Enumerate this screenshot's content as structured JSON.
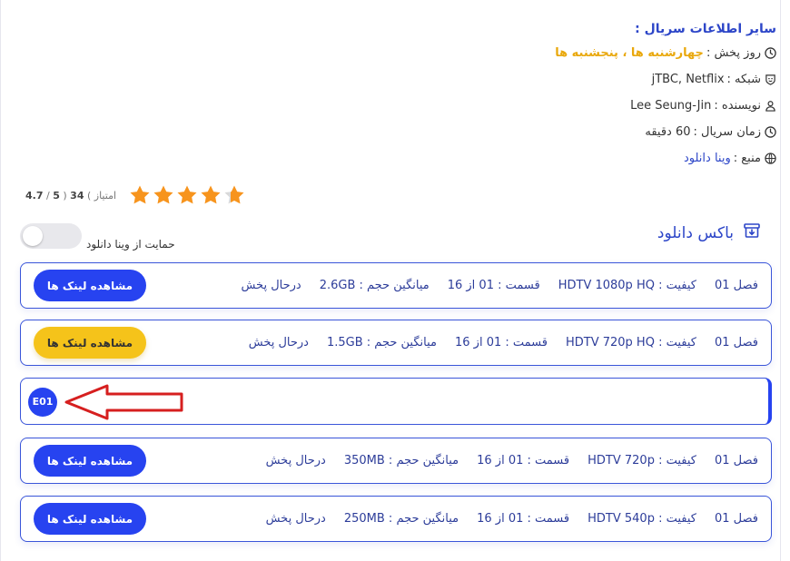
{
  "info": {
    "title": "سایر اطلاعات سریال :",
    "air_day_label": "روز پخش :",
    "air_day_value": "چهارشنبه ها ، پنجشنبه ها",
    "network_label": "شبکه :",
    "network_value": "jTBC, Netflix",
    "writer_label": "نویسنده :",
    "writer_value": "Lee Seung-Jin",
    "duration_label": "زمان سریال :",
    "duration_value": "60 دقیقه",
    "source_label": "منبع :",
    "source_value": "وینا دانلود"
  },
  "rating": {
    "score": "4.7",
    "sep": "/",
    "max": "5",
    "count_open": "(",
    "count": "34",
    "count_label": "امتیاز )",
    "stars_value": 4.7,
    "star_color": "#f7941d"
  },
  "download_box": {
    "title": "باکس دانلود",
    "support_label": "حمایت از وینا دانلود",
    "support_enabled": false
  },
  "rows": [
    {
      "season": "فصل 01",
      "quality": "کیفیت : HDTV 1080p HQ",
      "episode": "قسمت : 01 از 16",
      "size": "میانگین حجم : 2.6GB",
      "status": "درحال پخش",
      "button": "مشاهده لینک ها",
      "button_color": "#2743f0"
    },
    {
      "season": "فصل 01",
      "quality": "کیفیت : HDTV 720p HQ",
      "episode": "قسمت : 01 از 16",
      "size": "میانگین حجم : 1.5GB",
      "status": "درحال پخش",
      "button": "مشاهده لینک ها",
      "button_color": "#f5c31a"
    },
    {
      "season": "فصل 01",
      "quality": "کیفیت : HDTV 720p",
      "episode": "قسمت : 01 از 16",
      "size": "میانگین حجم : 350MB",
      "status": "درحال پخش",
      "button": "مشاهده لینک ها",
      "button_color": "#2743f0"
    },
    {
      "season": "فصل 01",
      "quality": "کیفیت : HDTV 540p",
      "episode": "قسمت : 01 از 16",
      "size": "میانگین حجم : 250MB",
      "status": "درحال پخش",
      "button": "مشاهده لینک ها",
      "button_color": "#2743f0"
    }
  ],
  "episode_badge": "E01",
  "colors": {
    "accent": "#2743f0",
    "gold": "#e9a80c",
    "arrow": "#d61f1f"
  },
  "icons": [
    "clock-icon",
    "shield-icon",
    "user-icon",
    "clock-icon",
    "globe-icon",
    "download-box-icon",
    "star-icon",
    "arrow-left-icon"
  ]
}
